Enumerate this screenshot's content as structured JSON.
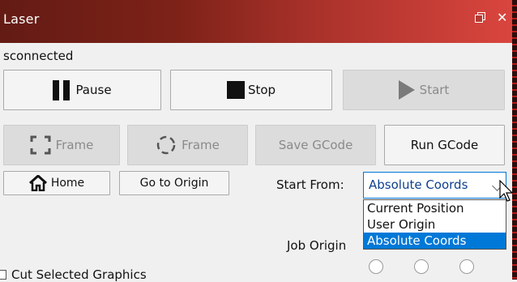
{
  "window": {
    "title": "Laser",
    "restore_icon": "restore-icon",
    "close_glyph": "✕",
    "accent_gradient": [
      "#631b14",
      "#d9453e"
    ]
  },
  "status": {
    "text": "sconnected"
  },
  "controls": {
    "pause_label": "Pause",
    "stop_label": "Stop",
    "start_label": "Start"
  },
  "frame_row": {
    "frame_rect_label": "Frame",
    "frame_circle_label": "Frame",
    "save_gcode_label": "Save GCode",
    "run_gcode_label": "Run GCode"
  },
  "positioning": {
    "home_label": "Home",
    "goto_origin_label": "Go to Origin",
    "start_from_label": "Start From:",
    "start_from_value": "Absolute Coords",
    "options": [
      "Current Position",
      "User Origin",
      "Absolute Coords"
    ],
    "selected_option": "Absolute Coords"
  },
  "job": {
    "job_origin_label": "Job Origin",
    "cut_selected_label": "Cut Selected Graphics"
  },
  "colors": {
    "selection_blue": "#0078d7",
    "disabled_bg": "#dcdcdc"
  }
}
